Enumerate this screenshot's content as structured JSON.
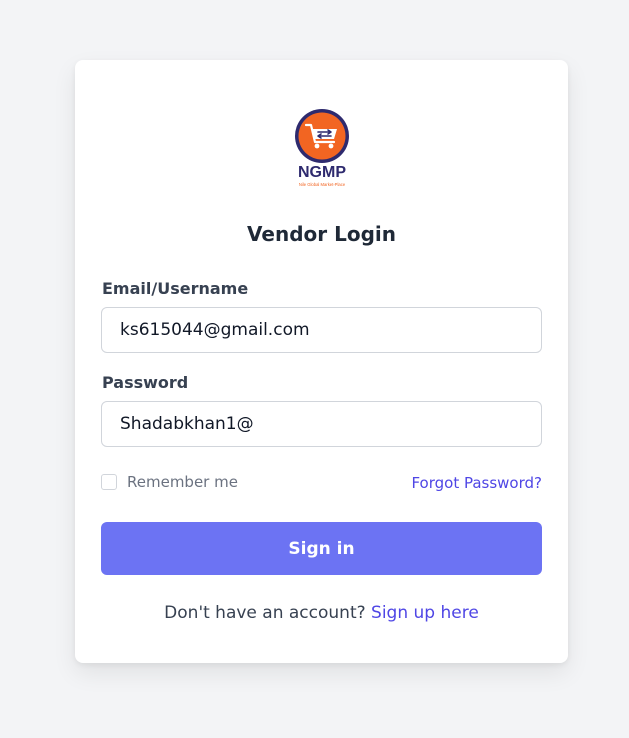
{
  "logo": {
    "brand": "NGMP",
    "tagline": "Nile Global Market-Place"
  },
  "login": {
    "title": "Vendor Login",
    "email_label": "Email/Username",
    "email_value": "ks615044@gmail.com",
    "password_label": "Password",
    "password_value": "Shadabkhan1@",
    "remember_label": "Remember me",
    "remember_checked": false,
    "forgot_label": "Forgot Password?",
    "signin_label": "Sign in",
    "signup_prompt": "Don't have an account?",
    "signup_link": "Sign up here"
  },
  "colors": {
    "page_background": "#f3f4f6",
    "card_background": "#ffffff",
    "primary_button": "#6c73f3",
    "link": "#4f46e5",
    "logo_circle": "#f26522",
    "logo_ring": "#2e2a6e"
  }
}
